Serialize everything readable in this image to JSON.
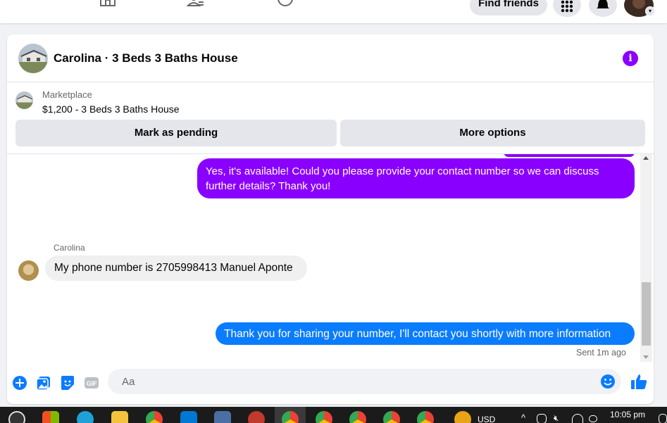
{
  "top_nav": {
    "find_friends_label": "Find friends",
    "icons": [
      "home-icon",
      "friends-icon",
      "groups-icon",
      "menu-grid-icon",
      "notifications-icon"
    ]
  },
  "chat": {
    "title": "Carolina · 3 Beds 3 Baths House",
    "marketplace": {
      "label": "Marketplace",
      "item": "$1,200 - 3 Beds 3 Baths House"
    },
    "buttons": {
      "mark_pending": "Mark as pending",
      "more_options": "More options"
    },
    "messages": [
      {
        "from": "me",
        "text": "Yes, it's available! Could you please provide your contact number so we can discuss further details? Thank you!"
      },
      {
        "from": "Carolina",
        "text": "My phone number is 2705998413 Manuel Aponte"
      },
      {
        "from": "me",
        "text": "Thank you for sharing your number, I'll contact you shortly with more information"
      }
    ],
    "sender_name": "Carolina",
    "sent_status": "Sent 1m ago",
    "composer": {
      "placeholder": "Aa"
    },
    "colors": {
      "outgoing_purple": "#8a00ff",
      "outgoing_blue": "#0a7cff",
      "incoming": "#f0f0f0"
    }
  },
  "taskbar": {
    "currency": "USD",
    "time": "10:05 pm"
  }
}
